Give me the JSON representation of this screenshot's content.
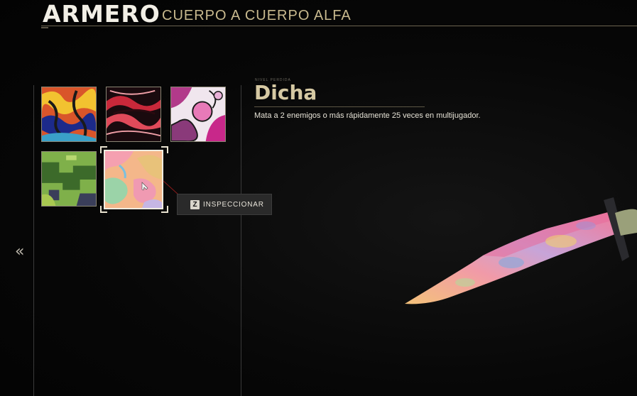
{
  "header": {
    "title": "ARMERO",
    "subtitle": "CUERPO A CUERPO ALFA"
  },
  "nav": {
    "back_icon": "double-chevron-left-icon",
    "back_glyph": "«"
  },
  "camo_grid": {
    "tiles": [
      {
        "name": "camo-tile-1",
        "selected": false
      },
      {
        "name": "camo-tile-2",
        "selected": false
      },
      {
        "name": "camo-tile-3",
        "selected": false
      },
      {
        "name": "camo-tile-4",
        "selected": false
      },
      {
        "name": "camo-tile-5",
        "selected": true
      }
    ]
  },
  "inspect": {
    "key": "Z",
    "label": "INSPECCIONAR"
  },
  "details": {
    "kicker": "NIVEL PERDIDA",
    "name": "Dicha",
    "description": "Mata a 2 enemigos o más rápidamente 25 veces en multijugador."
  },
  "colors": {
    "accent": "#d6c9a3",
    "background": "#050505"
  }
}
